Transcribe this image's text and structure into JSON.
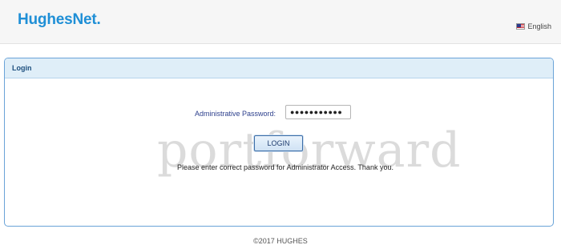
{
  "header": {
    "brand": "HughesNet",
    "brand_dot": ".",
    "language": "English",
    "flag_icon": "us-flag-icon"
  },
  "login_panel": {
    "title": "Login",
    "password_label": "Administrative Password:",
    "password_value": "●●●●●●●●●●●",
    "login_button": "LOGIN",
    "message": "Please enter correct password for Administrator Access. Thank you."
  },
  "watermark": "portforward",
  "footer": {
    "copyright": "©2017 HUGHES"
  },
  "colors": {
    "brand": "#1f8fd6",
    "panel_border": "#6aa3d8",
    "panel_header": "#dfeef8",
    "label": "#2c3f8c"
  }
}
